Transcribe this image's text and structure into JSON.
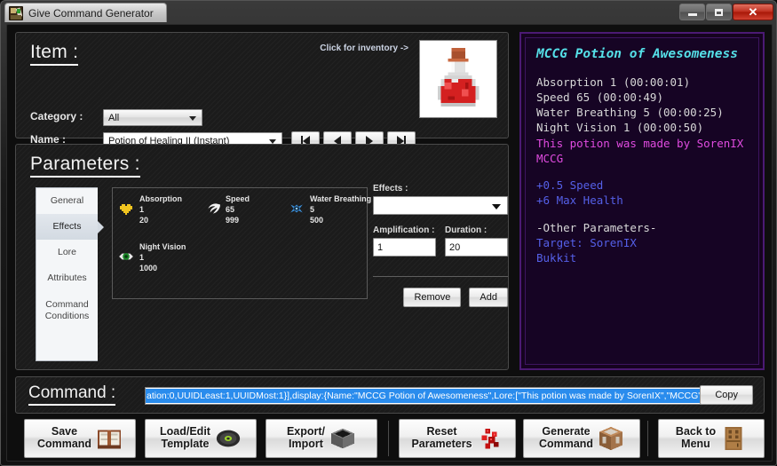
{
  "window": {
    "title": "Give Command Generator",
    "icon": "app-icon",
    "minimize_label": "–",
    "maximize_label": "□",
    "close_label": "✕"
  },
  "item": {
    "section_title": "Item :",
    "inventory_hint": "Click for inventory ->",
    "category_label": "Category :",
    "category_value": "All",
    "name_label": "Name :",
    "name_value": "Potion of Healing II (Instant)",
    "nav": [
      {
        "name": "first",
        "icon": "nav-first-icon"
      },
      {
        "name": "previous",
        "icon": "nav-previous-icon"
      },
      {
        "name": "next",
        "icon": "nav-next-icon"
      },
      {
        "name": "last",
        "icon": "nav-last-icon"
      }
    ],
    "item_icon": "potion-bottle-icon"
  },
  "parameters": {
    "section_title": "Parameters :",
    "tabs": [
      {
        "label": "General",
        "active": false
      },
      {
        "label": "Effects",
        "active": true
      },
      {
        "label": "Lore",
        "active": false
      },
      {
        "label": "Attributes",
        "active": false
      },
      {
        "label": "Command\nConditions",
        "active": false
      }
    ],
    "effects": [
      {
        "name": "Absorption",
        "amplification": "1",
        "duration": "20",
        "icon": "absorption-heart-icon"
      },
      {
        "name": "Speed",
        "amplification": "65",
        "duration": "999",
        "icon": "speed-swirl-icon"
      },
      {
        "name": "Water Breathing",
        "amplification": "5",
        "duration": "500",
        "icon": "water-breathing-fish-icon"
      },
      {
        "name": "Night Vision",
        "amplification": "1",
        "duration": "1000",
        "icon": "night-vision-eye-icon"
      }
    ],
    "controls": {
      "effects_label": "Effects :",
      "effects_value": "",
      "amplification_label": "Amplification :",
      "amplification_value": "1",
      "duration_label": "Duration :",
      "duration_value": "20",
      "remove_label": "Remove",
      "add_label": "Add"
    }
  },
  "preview": {
    "title": "MCCG Potion of Awesomeness",
    "lines": [
      {
        "text": "Absorption 1 (00:00:01)",
        "color": "white"
      },
      {
        "text": "Speed 65 (00:00:49)",
        "color": "white"
      },
      {
        "text": "Water Breathing 5 (00:00:25)",
        "color": "white"
      },
      {
        "text": "Night Vision 1 (00:00:50)",
        "color": "white"
      },
      {
        "text": "This potion was made by SorenIX",
        "color": "magenta"
      },
      {
        "text": "MCCG",
        "color": "magenta"
      },
      {
        "text": "",
        "color": "gap"
      },
      {
        "text": "+0.5 Speed",
        "color": "blue"
      },
      {
        "text": "+6 Max Health",
        "color": "blue"
      },
      {
        "text": "",
        "color": "gap"
      },
      {
        "text": "-Other Parameters-",
        "color": "white"
      },
      {
        "text": "Target: SorenIX",
        "color": "blue"
      },
      {
        "text": "Bukkit",
        "color": "blue"
      }
    ],
    "colors": {
      "title": "#55e0e8",
      "white": "#d8d8d8",
      "magenta": "#e04be0",
      "blue": "#5560e8",
      "border": "#4b1a73",
      "background": "#160424"
    }
  },
  "command": {
    "section_title": "Command :",
    "value": "ation:0,UUIDLeast:1,UUIDMost:1}],display:{Name:\"MCCG Potion of Awesomeness\",Lore:[\"This potion was made by SorenIX\",\"MCCG\"]}}",
    "selected": true,
    "selection_color": "#2a8ced",
    "copy_label": "Copy"
  },
  "actions": [
    {
      "label": "Save\nCommand",
      "icon": "book-icon",
      "name": "save-command-button"
    },
    {
      "label": "Load/Edit\nTemplate",
      "icon": "music-disc-icon",
      "name": "load-edit-template-button"
    },
    {
      "label": "Export/\nImport",
      "icon": "cauldron-icon",
      "name": "export-import-button"
    },
    {
      "label": "Reset\nParameters",
      "icon": "redstone-dust-icon",
      "name": "reset-parameters-button"
    },
    {
      "label": "Generate\nCommand",
      "icon": "command-block-icon",
      "name": "generate-command-button"
    },
    {
      "label": "Back to\nMenu",
      "icon": "door-icon",
      "name": "back-to-menu-button"
    }
  ]
}
